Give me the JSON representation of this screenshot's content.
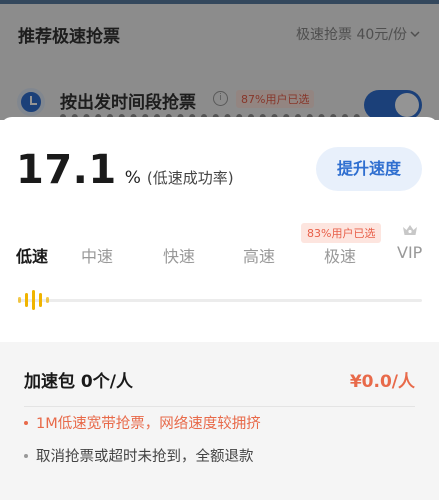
{
  "background": {
    "title": "推荐极速抢票",
    "price_note": "极速抢票 40元/份",
    "option_title": "按出发时间段抢票",
    "option_badge": "87%用户已选",
    "option_toggle_on": true
  },
  "rate": {
    "value": "17.1",
    "unit": "%",
    "label": "(低速成功率)"
  },
  "boost_button": "提升速度",
  "speed_badge": "83%用户已选",
  "speed_tabs": [
    "低速",
    "中速",
    "快速",
    "高速",
    "极速",
    "VIP"
  ],
  "selected_speed": "低速",
  "speed_level_fraction": 0,
  "package": {
    "title": "加速包 0个/人",
    "price": "¥0.0/人",
    "notes": [
      "1M低速宽带抢票，网络速度较拥挤",
      "取消抢票或超时未抢到，全额退款"
    ]
  },
  "colors": {
    "accent_blue": "#2f6fd0",
    "accent_orange": "#e86a4a",
    "slider_handle": "#f0b400"
  }
}
